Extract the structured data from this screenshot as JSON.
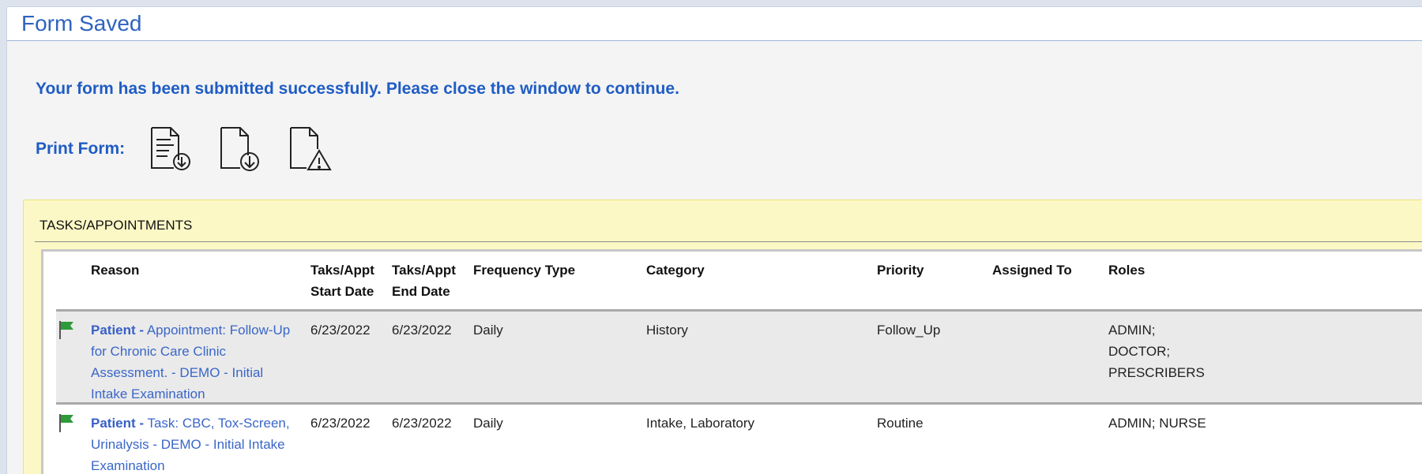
{
  "window": {
    "title": "Form Saved"
  },
  "message": "Your form has been submitted successfully. Please close the window to continue.",
  "print": {
    "label": "Print Form:",
    "icons": [
      "document-download-icon",
      "blank-document-download-icon",
      "document-warning-icon"
    ]
  },
  "panel": {
    "title": "TASKS/APPOINTMENTS"
  },
  "table": {
    "headers": {
      "reason": "Reason",
      "start_line1": "Taks/Appt",
      "start_line2": "Start Date",
      "end_line1": "Taks/Appt",
      "end_line2": "End Date",
      "frequency": "Frequency Type",
      "category": "Category",
      "priority": "Priority",
      "assigned": "Assigned To",
      "roles": "Roles"
    },
    "rows": [
      {
        "flag": "green-flag-icon",
        "reason_type": "Patient -",
        "reason_text": " Appointment: Follow-Up for Chronic Care Clinic Assessment. - DEMO - Initial Intake Examination",
        "start": "6/23/2022",
        "end": "6/23/2022",
        "frequency": "Daily",
        "category": "History",
        "priority": "Follow_Up",
        "assigned": "",
        "roles": "ADMIN; DOCTOR; PRESCRIBERS"
      },
      {
        "flag": "green-flag-icon",
        "reason_type": "Patient -",
        "reason_text": " Task: CBC, Tox-Screen, Urinalysis - DEMO - Initial Intake Examination",
        "start": "6/23/2022",
        "end": "6/23/2022",
        "frequency": "Daily",
        "category": "Intake, Laboratory",
        "priority": "Routine",
        "assigned": "",
        "roles": "ADMIN; NURSE"
      }
    ]
  },
  "colors": {
    "accent": "#1f5cc4",
    "panel_bg": "#fcf8c6",
    "flag": "#2e9a3a"
  }
}
